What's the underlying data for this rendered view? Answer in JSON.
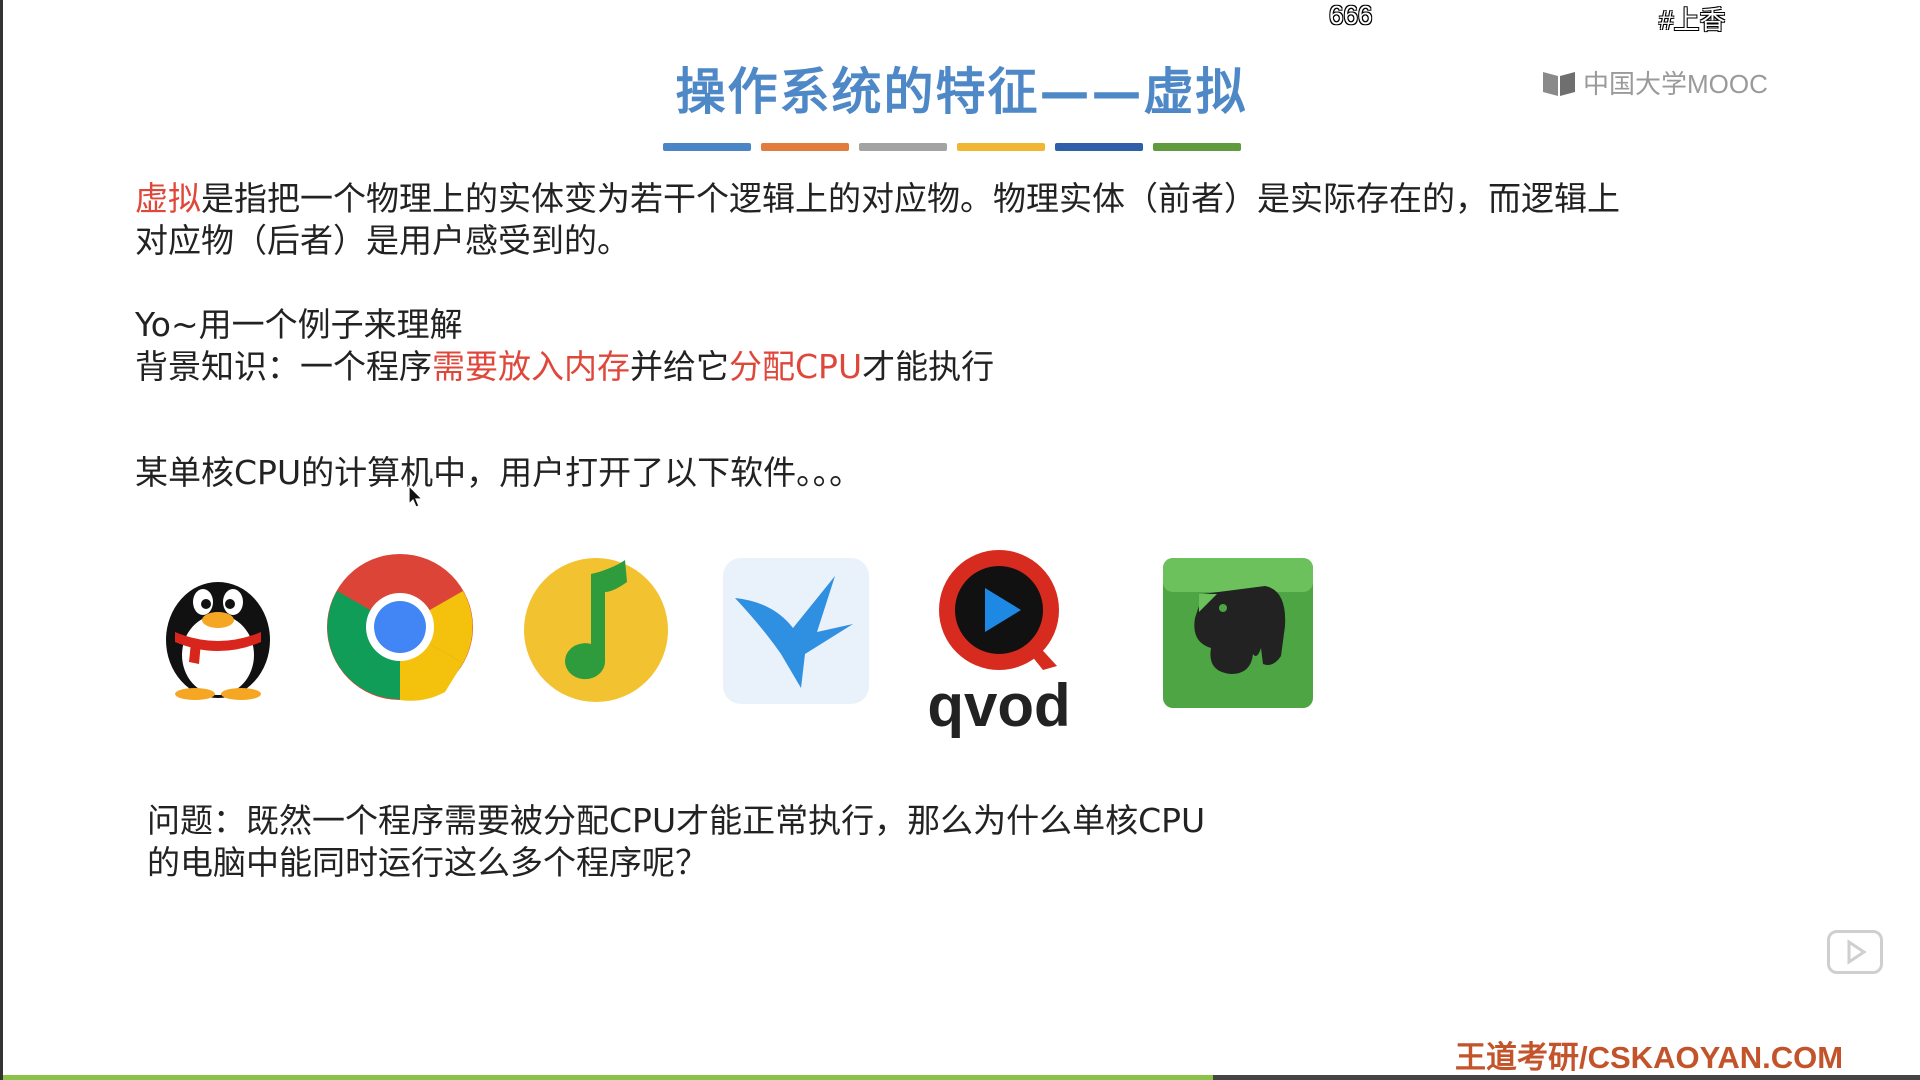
{
  "danmaku": [
    "666",
    "#上香"
  ],
  "slide": {
    "title": "操作系统的特征——虚拟",
    "title_bar_colors": [
      "#4a86c5",
      "#e37a3e",
      "#a3a3a3",
      "#f1b733",
      "#2f5fa8",
      "#5f9a3e"
    ],
    "logo_text": "中国大学MOOC",
    "definition": {
      "term": "虚拟",
      "line1_rest": "是指把一个物理上的实体变为若干个逻辑上的对应物。物理实体（前者）是实际存在的，而逻辑上",
      "line2": "对应物（后者）是用户感受到的。"
    },
    "example_intro": "Yo~用一个例子来理解",
    "background": {
      "prefix": "背景知识：一个程序",
      "highlight1": "需要放入内存",
      "middle": "并给它",
      "highlight2": "分配CPU",
      "suffix": "才能执行"
    },
    "scenario": "某单核CPU的计算机中，用户打开了以下软件。。。",
    "apps": [
      "qq-icon",
      "chrome-icon",
      "qq-music-icon",
      "xunlei-icon",
      "qvod-icon",
      "evernote-icon"
    ],
    "qvod_label": "qvod",
    "question_line1": "问题：既然一个程序需要被分配CPU才能正常执行，那么为什么单核CPU",
    "question_line2": "的电脑中能同时运行这么多个程序呢？",
    "watermark": "王道考研/CSKAOYAN.COM"
  },
  "player": {
    "progress": 0.63,
    "accent": "#8bc34a"
  }
}
